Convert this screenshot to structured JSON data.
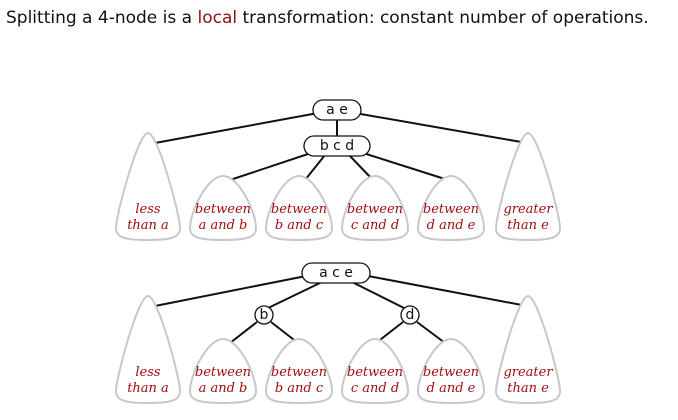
{
  "headline": {
    "before": "Splitting a 4-node is a ",
    "highlight": "local",
    "after": " transformation: constant number of operations."
  },
  "top_tree": {
    "root_keys": "a e",
    "middle_keys": "b c d",
    "subtrees": [
      {
        "line1": "less",
        "line2": "than a"
      },
      {
        "line1": "between",
        "line2": "a and b"
      },
      {
        "line1": "between",
        "line2": "b and c"
      },
      {
        "line1": "between",
        "line2": "c and d"
      },
      {
        "line1": "between",
        "line2": "d and e"
      },
      {
        "line1": "greater",
        "line2": "than e"
      }
    ]
  },
  "bottom_tree": {
    "root_keys": "a c e",
    "left_key": "b",
    "right_key": "d",
    "subtrees": [
      {
        "line1": "less",
        "line2": "than a"
      },
      {
        "line1": "between",
        "line2": "a and b"
      },
      {
        "line1": "between",
        "line2": "b and c"
      },
      {
        "line1": "between",
        "line2": "c and d"
      },
      {
        "line1": "between",
        "line2": "d and e"
      },
      {
        "line1": "greater",
        "line2": "than e"
      }
    ]
  }
}
